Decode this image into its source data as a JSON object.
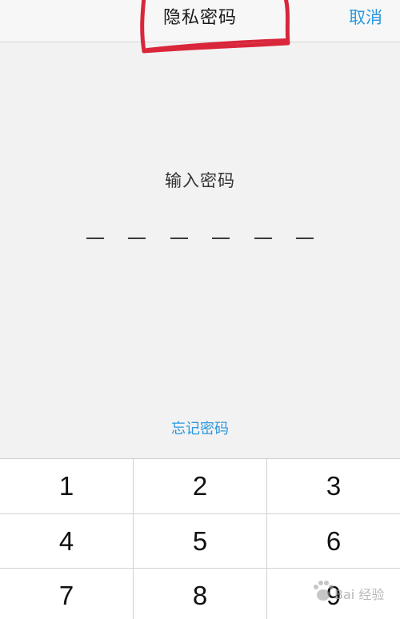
{
  "nav": {
    "title": "隐私密码",
    "cancel_label": "取消"
  },
  "prompt": "输入密码",
  "pin": {
    "length": 6,
    "entered": 0
  },
  "forgot_label": "忘记密码",
  "keypad": {
    "keys": [
      "1",
      "2",
      "3",
      "4",
      "5",
      "6",
      "7",
      "8",
      "9"
    ]
  },
  "watermark": "Bai 经验",
  "colors": {
    "accent": "#2a98e0",
    "annotation": "#d9263a",
    "background": "#f2f2f2"
  }
}
